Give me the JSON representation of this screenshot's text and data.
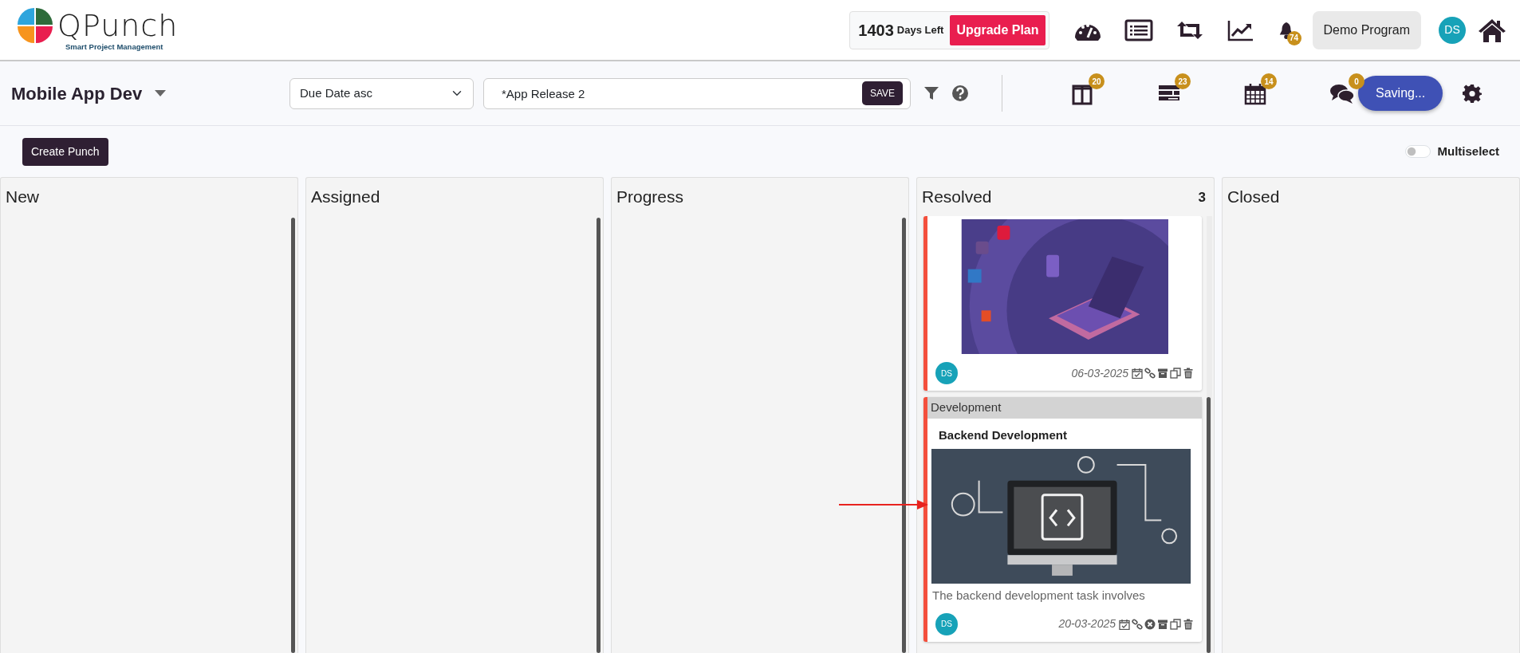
{
  "header": {
    "logo": {
      "name": "QPunch",
      "tagline": "Smart Project Management"
    },
    "days_left": {
      "count": "1403",
      "label": "Days Left"
    },
    "upgrade_button": "Upgrade Plan",
    "notifications_badge": "74",
    "program_button": "Demo Program",
    "user_initials": "DS"
  },
  "toolbar": {
    "project": "Mobile App Dev",
    "sort": "Due Date asc",
    "filter_value": "*App Release 2",
    "save_button": "SAVE",
    "views": [
      {
        "kind": "board",
        "badge": "20"
      },
      {
        "kind": "list",
        "badge": "23"
      },
      {
        "kind": "calendar",
        "badge": "14"
      }
    ],
    "comments_badge": "0",
    "status_button": "Saving..."
  },
  "actions": {
    "create_button": "Create Punch",
    "multiselect": {
      "label": "Multiselect",
      "on": false
    }
  },
  "columns": [
    {
      "title": "New"
    },
    {
      "title": "Assigned"
    },
    {
      "title": "Progress"
    },
    {
      "title": "Resolved",
      "count": "3",
      "cards": [
        {
          "date": "06-03-2025",
          "assignee": "DS",
          "cancelable": false
        },
        {
          "category": "Development",
          "title": "Backend Development",
          "description": "The backend development task involves",
          "date": "20-03-2025",
          "assignee": "DS",
          "cancelable": true
        }
      ]
    },
    {
      "title": "Closed"
    }
  ]
}
